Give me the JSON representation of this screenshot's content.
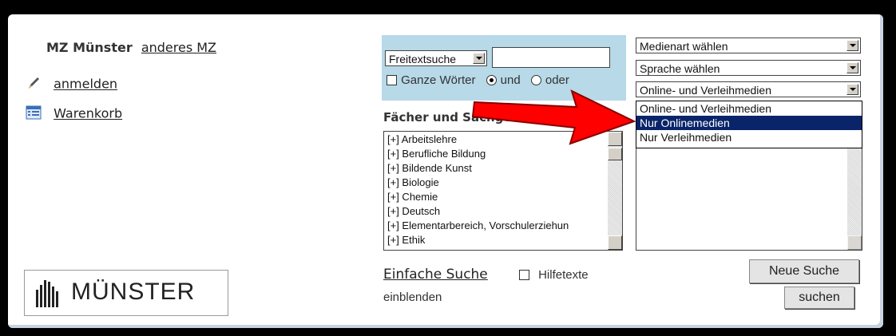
{
  "left": {
    "mz_name": "MZ Münster",
    "other_mz_link": "anderes MZ",
    "login_label": "anmelden",
    "cart_label": "Warenkorb",
    "logo_text": "MÜNSTER"
  },
  "search": {
    "mode_select": "Freitextsuche",
    "text_value": "",
    "whole_words_label": "Ganze Wörter",
    "and_label": "und",
    "or_label": "oder",
    "and_checked": true
  },
  "subjects": {
    "heading": "Fächer und Sachgebiete:",
    "items": [
      "[+] Arbeitslehre",
      "[+] Berufliche Bildung",
      "[+] Bildende Kunst",
      "[+] Biologie",
      "[+] Chemie",
      "[+] Deutsch",
      "[+] Elementarbereich, Vorschulerziehun",
      "[+] Ethik"
    ]
  },
  "filters": {
    "media_type": "Medienart wählen",
    "language": "Sprache wählen",
    "availability": "Online- und Verleihmedien",
    "availability_options": [
      "Online- und Verleihmedien",
      "Nur Onlinemedien",
      "Nur Verleihmedien"
    ],
    "highlighted_index": 1
  },
  "bottom": {
    "simple_search": "Einfache Suche",
    "help_label_1": "Hilfetexte",
    "help_label_2": "einblenden",
    "new_search": "Neue Suche",
    "search": "suchen"
  },
  "colors": {
    "blue_box": "#b7d9e8",
    "highlight": "#0a246a",
    "arrow": "#ff0000"
  }
}
